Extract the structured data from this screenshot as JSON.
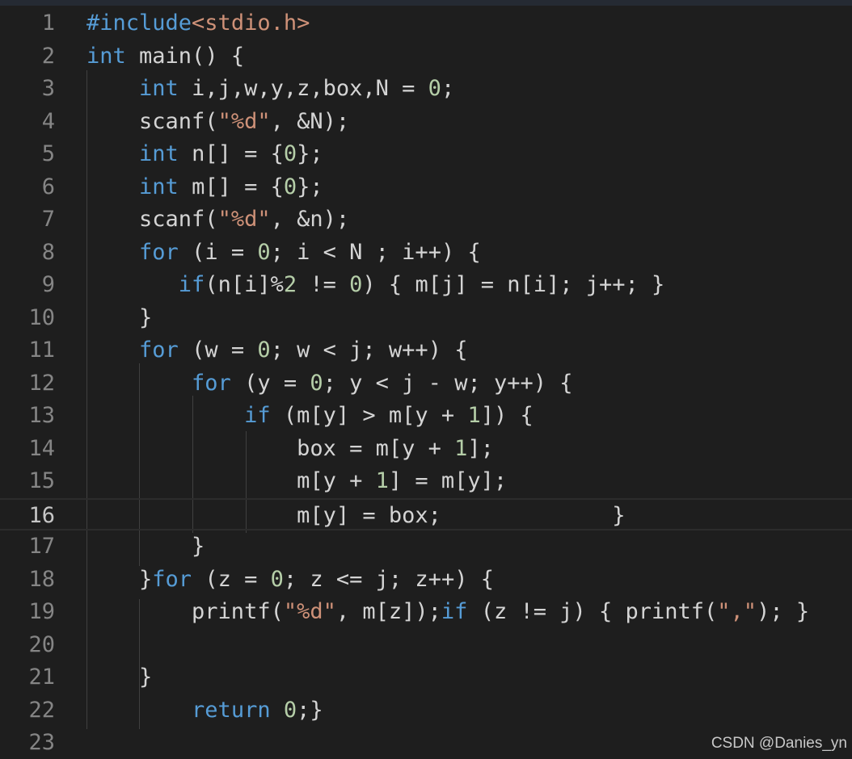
{
  "editor": {
    "language": "C",
    "active_line": 16,
    "lines": [
      {
        "num": "1",
        "tokens": [
          {
            "t": "#include",
            "c": "kw"
          },
          {
            "t": "<stdio.h>",
            "c": "str"
          }
        ]
      },
      {
        "num": "2",
        "tokens": [
          {
            "t": "int",
            "c": "kw"
          },
          {
            "t": " main() {",
            "c": ""
          }
        ]
      },
      {
        "num": "3",
        "tokens": [
          {
            "t": "    ",
            "c": ""
          },
          {
            "t": "int",
            "c": "kw"
          },
          {
            "t": " i,j,w,y,z,box,N = ",
            "c": ""
          },
          {
            "t": "0",
            "c": "num"
          },
          {
            "t": ";",
            "c": ""
          }
        ]
      },
      {
        "num": "4",
        "tokens": [
          {
            "t": "    scanf(",
            "c": ""
          },
          {
            "t": "\"%d\"",
            "c": "str"
          },
          {
            "t": ", &N);",
            "c": ""
          }
        ]
      },
      {
        "num": "5",
        "tokens": [
          {
            "t": "    ",
            "c": ""
          },
          {
            "t": "int",
            "c": "kw"
          },
          {
            "t": " n[] = {",
            "c": ""
          },
          {
            "t": "0",
            "c": "num"
          },
          {
            "t": "};",
            "c": ""
          }
        ]
      },
      {
        "num": "6",
        "tokens": [
          {
            "t": "    ",
            "c": ""
          },
          {
            "t": "int",
            "c": "kw"
          },
          {
            "t": " m[] = {",
            "c": ""
          },
          {
            "t": "0",
            "c": "num"
          },
          {
            "t": "};",
            "c": ""
          }
        ]
      },
      {
        "num": "7",
        "tokens": [
          {
            "t": "    scanf(",
            "c": ""
          },
          {
            "t": "\"%d\"",
            "c": "str"
          },
          {
            "t": ", &n);",
            "c": ""
          }
        ]
      },
      {
        "num": "8",
        "tokens": [
          {
            "t": "    ",
            "c": ""
          },
          {
            "t": "for",
            "c": "kw"
          },
          {
            "t": " (i = ",
            "c": ""
          },
          {
            "t": "0",
            "c": "num"
          },
          {
            "t": "; i < N ; i++) {",
            "c": ""
          }
        ]
      },
      {
        "num": "9",
        "tokens": [
          {
            "t": "       ",
            "c": ""
          },
          {
            "t": "if",
            "c": "kw"
          },
          {
            "t": "(n[i]%",
            "c": ""
          },
          {
            "t": "2",
            "c": "num"
          },
          {
            "t": " != ",
            "c": ""
          },
          {
            "t": "0",
            "c": "num"
          },
          {
            "t": ") { m[j] = n[i]; j++; }",
            "c": ""
          }
        ]
      },
      {
        "num": "10",
        "tokens": [
          {
            "t": "    }",
            "c": ""
          }
        ]
      },
      {
        "num": "11",
        "tokens": [
          {
            "t": "    ",
            "c": ""
          },
          {
            "t": "for",
            "c": "kw"
          },
          {
            "t": " (w = ",
            "c": ""
          },
          {
            "t": "0",
            "c": "num"
          },
          {
            "t": "; w < j; w++) {",
            "c": ""
          }
        ]
      },
      {
        "num": "12",
        "tokens": [
          {
            "t": "        ",
            "c": ""
          },
          {
            "t": "for",
            "c": "kw"
          },
          {
            "t": " (y = ",
            "c": ""
          },
          {
            "t": "0",
            "c": "num"
          },
          {
            "t": "; y < j - w; y++) {",
            "c": ""
          }
        ]
      },
      {
        "num": "13",
        "tokens": [
          {
            "t": "            ",
            "c": ""
          },
          {
            "t": "if",
            "c": "kw"
          },
          {
            "t": " (m[y] > m[y + ",
            "c": ""
          },
          {
            "t": "1",
            "c": "num"
          },
          {
            "t": "]) {",
            "c": ""
          }
        ]
      },
      {
        "num": "14",
        "tokens": [
          {
            "t": "                box = m[y + ",
            "c": ""
          },
          {
            "t": "1",
            "c": "num"
          },
          {
            "t": "];",
            "c": ""
          }
        ]
      },
      {
        "num": "15",
        "tokens": [
          {
            "t": "                m[y + ",
            "c": ""
          },
          {
            "t": "1",
            "c": "num"
          },
          {
            "t": "] = m[y];",
            "c": ""
          }
        ]
      },
      {
        "num": "16",
        "tokens": [
          {
            "t": "                m[y] = box;             }",
            "c": ""
          }
        ]
      },
      {
        "num": "17",
        "tokens": [
          {
            "t": "        }",
            "c": ""
          }
        ]
      },
      {
        "num": "18",
        "tokens": [
          {
            "t": "    }",
            "c": ""
          },
          {
            "t": "for",
            "c": "kw"
          },
          {
            "t": " (z = ",
            "c": ""
          },
          {
            "t": "0",
            "c": "num"
          },
          {
            "t": "; z <= j; z++) {",
            "c": ""
          }
        ]
      },
      {
        "num": "19",
        "tokens": [
          {
            "t": "        printf(",
            "c": ""
          },
          {
            "t": "\"%d\"",
            "c": "str"
          },
          {
            "t": ", m[z]);",
            "c": ""
          },
          {
            "t": "if",
            "c": "kw"
          },
          {
            "t": " (z != j) { printf(",
            "c": ""
          },
          {
            "t": "\",\"",
            "c": "str"
          },
          {
            "t": "); }",
            "c": ""
          }
        ]
      },
      {
        "num": "20",
        "tokens": [
          {
            "t": "",
            "c": ""
          }
        ]
      },
      {
        "num": "21",
        "tokens": [
          {
            "t": "    }",
            "c": ""
          }
        ]
      },
      {
        "num": "22",
        "tokens": [
          {
            "t": "        ",
            "c": ""
          },
          {
            "t": "return",
            "c": "kw"
          },
          {
            "t": " ",
            "c": ""
          },
          {
            "t": "0",
            "c": "num"
          },
          {
            "t": ";}",
            "c": ""
          }
        ]
      },
      {
        "num": "23",
        "tokens": [
          {
            "t": "",
            "c": ""
          }
        ]
      }
    ]
  },
  "watermark": "CSDN @Danies_yn",
  "colors": {
    "background": "#1e1e1e",
    "keyword": "#569cd6",
    "string": "#ce9178",
    "number": "#b5cea8",
    "text": "#d4d4d4",
    "line_number": "#858585"
  }
}
